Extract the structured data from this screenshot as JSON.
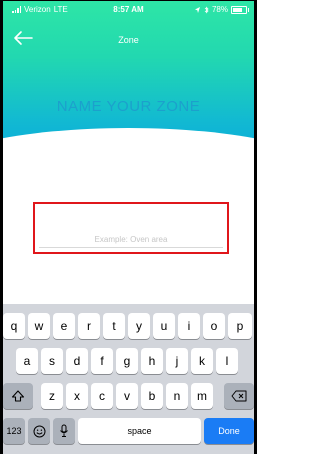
{
  "status_bar": {
    "carrier": "Verizon",
    "network": "LTE",
    "time": "8:57 AM",
    "battery": "78%"
  },
  "nav": {
    "title": "Zone",
    "back_icon": "arrow-left-icon"
  },
  "hero": {
    "heading": "NAME YOUR ZONE",
    "colors": {
      "top": "#2ee6a6",
      "bottom": "#0aa8dc",
      "heading": "#1ca0cc"
    }
  },
  "zone_input": {
    "placeholder": "Example: Oven area",
    "value": "",
    "highlight_color": "#e0161b"
  },
  "keyboard": {
    "row1": [
      "q",
      "w",
      "e",
      "r",
      "t",
      "y",
      "u",
      "i",
      "o",
      "p"
    ],
    "row2": [
      "a",
      "s",
      "d",
      "f",
      "g",
      "h",
      "j",
      "k",
      "l"
    ],
    "row3": [
      "z",
      "x",
      "c",
      "v",
      "b",
      "n",
      "m"
    ],
    "shift_icon": "shift-icon",
    "delete_icon": "backspace-icon",
    "numbers_label": "123",
    "emoji_icon": "emoji-icon",
    "mic_icon": "microphone-icon",
    "space_label": "space",
    "done_label": "Done",
    "done_color": "#1a7cf5"
  }
}
